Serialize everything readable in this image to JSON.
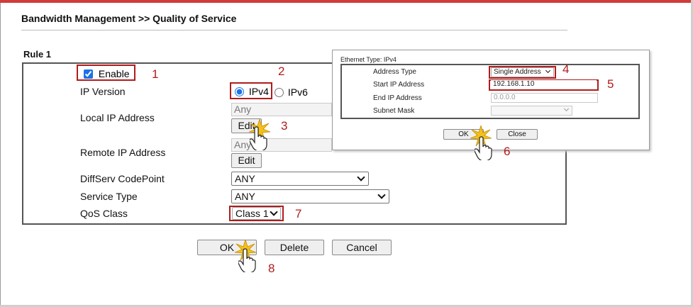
{
  "page": {
    "title": "Bandwidth Management >> Quality of Service"
  },
  "rule": {
    "title": "Rule 1",
    "enable_label": "Enable",
    "enable_checked": true,
    "ip_version_label": "IP Version",
    "ipv4_label": "IPv4",
    "ipv6_label": "IPv6",
    "local_ip_label": "Local IP Address",
    "local_ip_value": "Any",
    "local_edit_label": "Edit",
    "remote_ip_label": "Remote IP Address",
    "remote_ip_value": "Any",
    "remote_edit_label": "Edit",
    "diffserv_label": "DiffServ CodePoint",
    "diffserv_value": "ANY",
    "service_type_label": "Service Type",
    "service_type_value": "ANY",
    "qos_class_label": "QoS Class",
    "qos_class_value": "Class 1"
  },
  "buttons": {
    "ok": "OK",
    "delete": "Delete",
    "cancel": "Cancel"
  },
  "popup": {
    "title": "Ethernet Type: IPv4",
    "address_type_label": "Address Type",
    "address_type_value": "Single Address",
    "start_ip_label": "Start IP Address",
    "start_ip_value": "192.168.1.10",
    "end_ip_label": "End IP Address",
    "end_ip_placeholder": "0.0.0.0",
    "subnet_mask_label": "Subnet Mask",
    "subnet_mask_value": "",
    "ok_label": "OK",
    "close_label": "Close"
  },
  "annotations": {
    "n1": "1",
    "n2": "2",
    "n3": "3",
    "n4": "4",
    "n5": "5",
    "n6": "6",
    "n7": "7",
    "n8": "8"
  },
  "colors": {
    "accent_red": "#b01c1c",
    "top_bar": "#d23b3b",
    "check_blue": "#1a73e8"
  },
  "icons": {
    "pointer": "hand-pointer-icon",
    "click_burst": "click-burst-icon"
  }
}
